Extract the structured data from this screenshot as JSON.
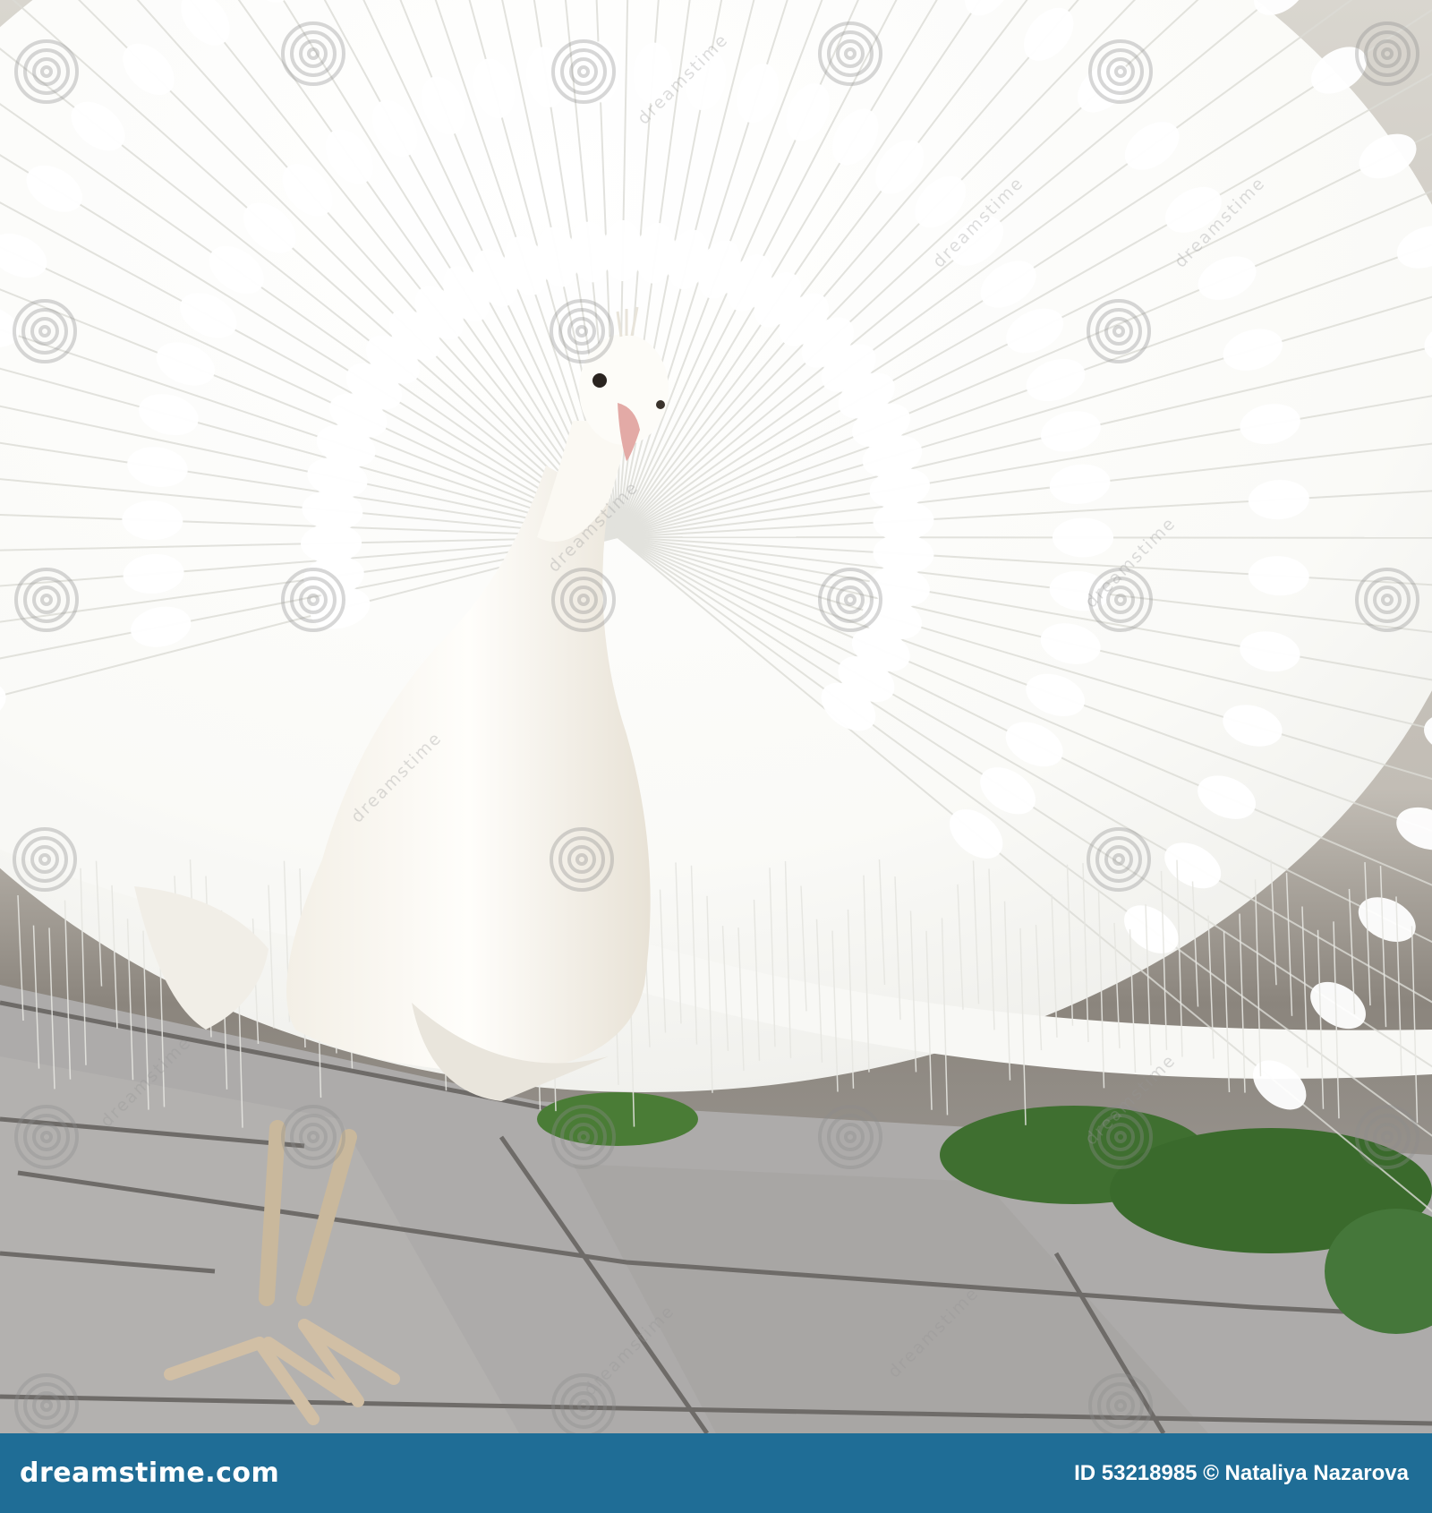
{
  "scene": {
    "subject": "white-peacock",
    "colors": {
      "plumage": "#fbfbf8",
      "body_shadow": "#ece7dc",
      "legs": "#c9b89c",
      "beak": "#e3aaa6",
      "pavement": "#adabaa",
      "pavement_joint": "#6e6b68",
      "foliage": "#3f6f30",
      "wall": "#8a8580",
      "footer": "#1f6d96"
    }
  },
  "watermark": {
    "text": "dreamstime",
    "swirl_icon": "swirl-watermark-icon"
  },
  "footer": {
    "logo_text": "dreamstime.com",
    "credit": "ID 53218985 © Nataliya Nazarova"
  }
}
